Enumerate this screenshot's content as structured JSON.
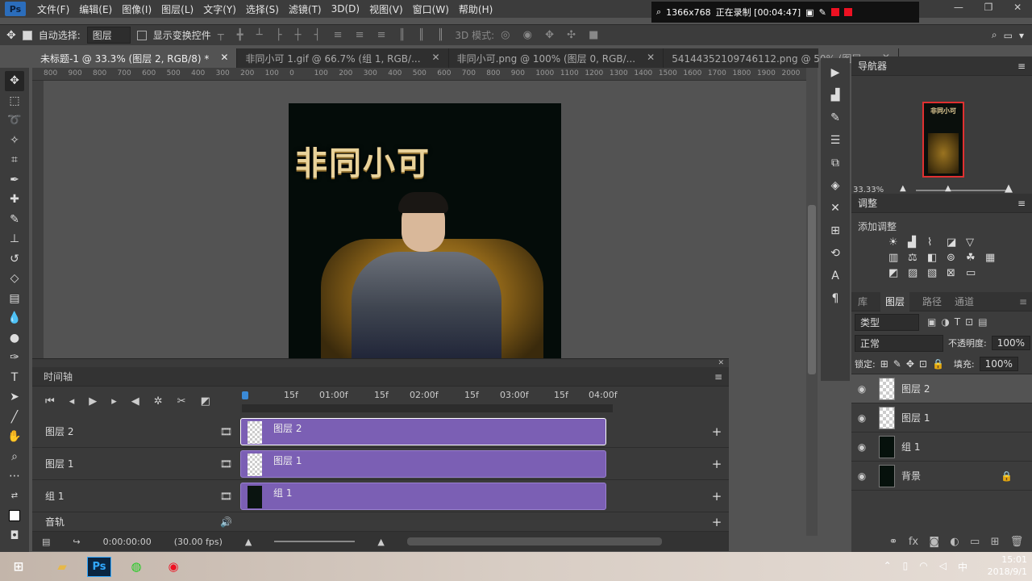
{
  "app": {
    "logo": "Ps"
  },
  "menu": [
    "文件(F)",
    "编辑(E)",
    "图像(I)",
    "图层(L)",
    "文字(Y)",
    "选择(S)",
    "滤镜(T)",
    "3D(D)",
    "视图(V)",
    "窗口(W)",
    "帮助(H)"
  ],
  "recorder": {
    "resolution": "1366x768",
    "status": "正在录制 [00:04:47]"
  },
  "options": {
    "auto_select_label": "自动选择:",
    "auto_select_value": "图层",
    "show_transform_label": "显示变换控件",
    "mode3d_label": "3D 模式:"
  },
  "tabs": [
    {
      "label": "未标题-1 @ 33.3% (图层 2, RGB/8) *",
      "active": true
    },
    {
      "label": "非同小可 1.gif @ 66.7% (组 1, RGB/...",
      "active": false
    },
    {
      "label": "非同小可.png @ 100% (图层 0, RGB/...",
      "active": false
    },
    {
      "label": "54144352109746112.png @ 50% (图层...",
      "active": false
    }
  ],
  "ruler_top": [
    "800",
    "900",
    "800",
    "700",
    "600",
    "500",
    "400",
    "300",
    "200",
    "100",
    "0",
    "100",
    "200",
    "300",
    "400",
    "500",
    "600",
    "700",
    "800",
    "900",
    "1000",
    "1100",
    "1200",
    "1300",
    "1400",
    "1500",
    "1600",
    "1700",
    "1800",
    "1900",
    "2000"
  ],
  "document": {
    "title_art": "非同小可"
  },
  "navigator": {
    "title": "导航器",
    "zoom": "33.33%"
  },
  "adjustments": {
    "title": "调整",
    "add_label": "添加调整"
  },
  "layers_panel": {
    "tabs": [
      "库",
      "图层",
      "路径",
      "通道"
    ],
    "active_tab": "图层",
    "filter_label": "类型",
    "blend_mode": "正常",
    "opacity_label": "不透明度:",
    "opacity_value": "100%",
    "lock_label": "锁定:",
    "fill_label": "填充:",
    "fill_value": "100%",
    "layers": [
      {
        "name": "图层 2",
        "selected": true,
        "dark": false
      },
      {
        "name": "图层 1",
        "selected": false,
        "dark": false
      },
      {
        "name": "组 1",
        "selected": false,
        "dark": true
      },
      {
        "name": "背景",
        "selected": false,
        "dark": true
      }
    ]
  },
  "timeline": {
    "title": "时间轴",
    "ruler": [
      "15f",
      "01:00f",
      "15f",
      "02:00f",
      "15f",
      "03:00f",
      "15f",
      "04:00f"
    ],
    "tracks": [
      {
        "name": "图层 2",
        "clip": "图层 2",
        "selected": true
      },
      {
        "name": "图层 1",
        "clip": "图层 1",
        "selected": false
      },
      {
        "name": "组 1",
        "clip": "组 1",
        "selected": false
      }
    ],
    "audio_label": "音轨",
    "time": "0:00:00:00",
    "fps": "(30.00 fps)"
  },
  "clock": {
    "time": "15:01",
    "date": "2018/9/1"
  },
  "colors": {
    "accent_clip": "#7b5fb4",
    "bg_panel": "#3c3c3c",
    "record_red": "#e12222"
  }
}
